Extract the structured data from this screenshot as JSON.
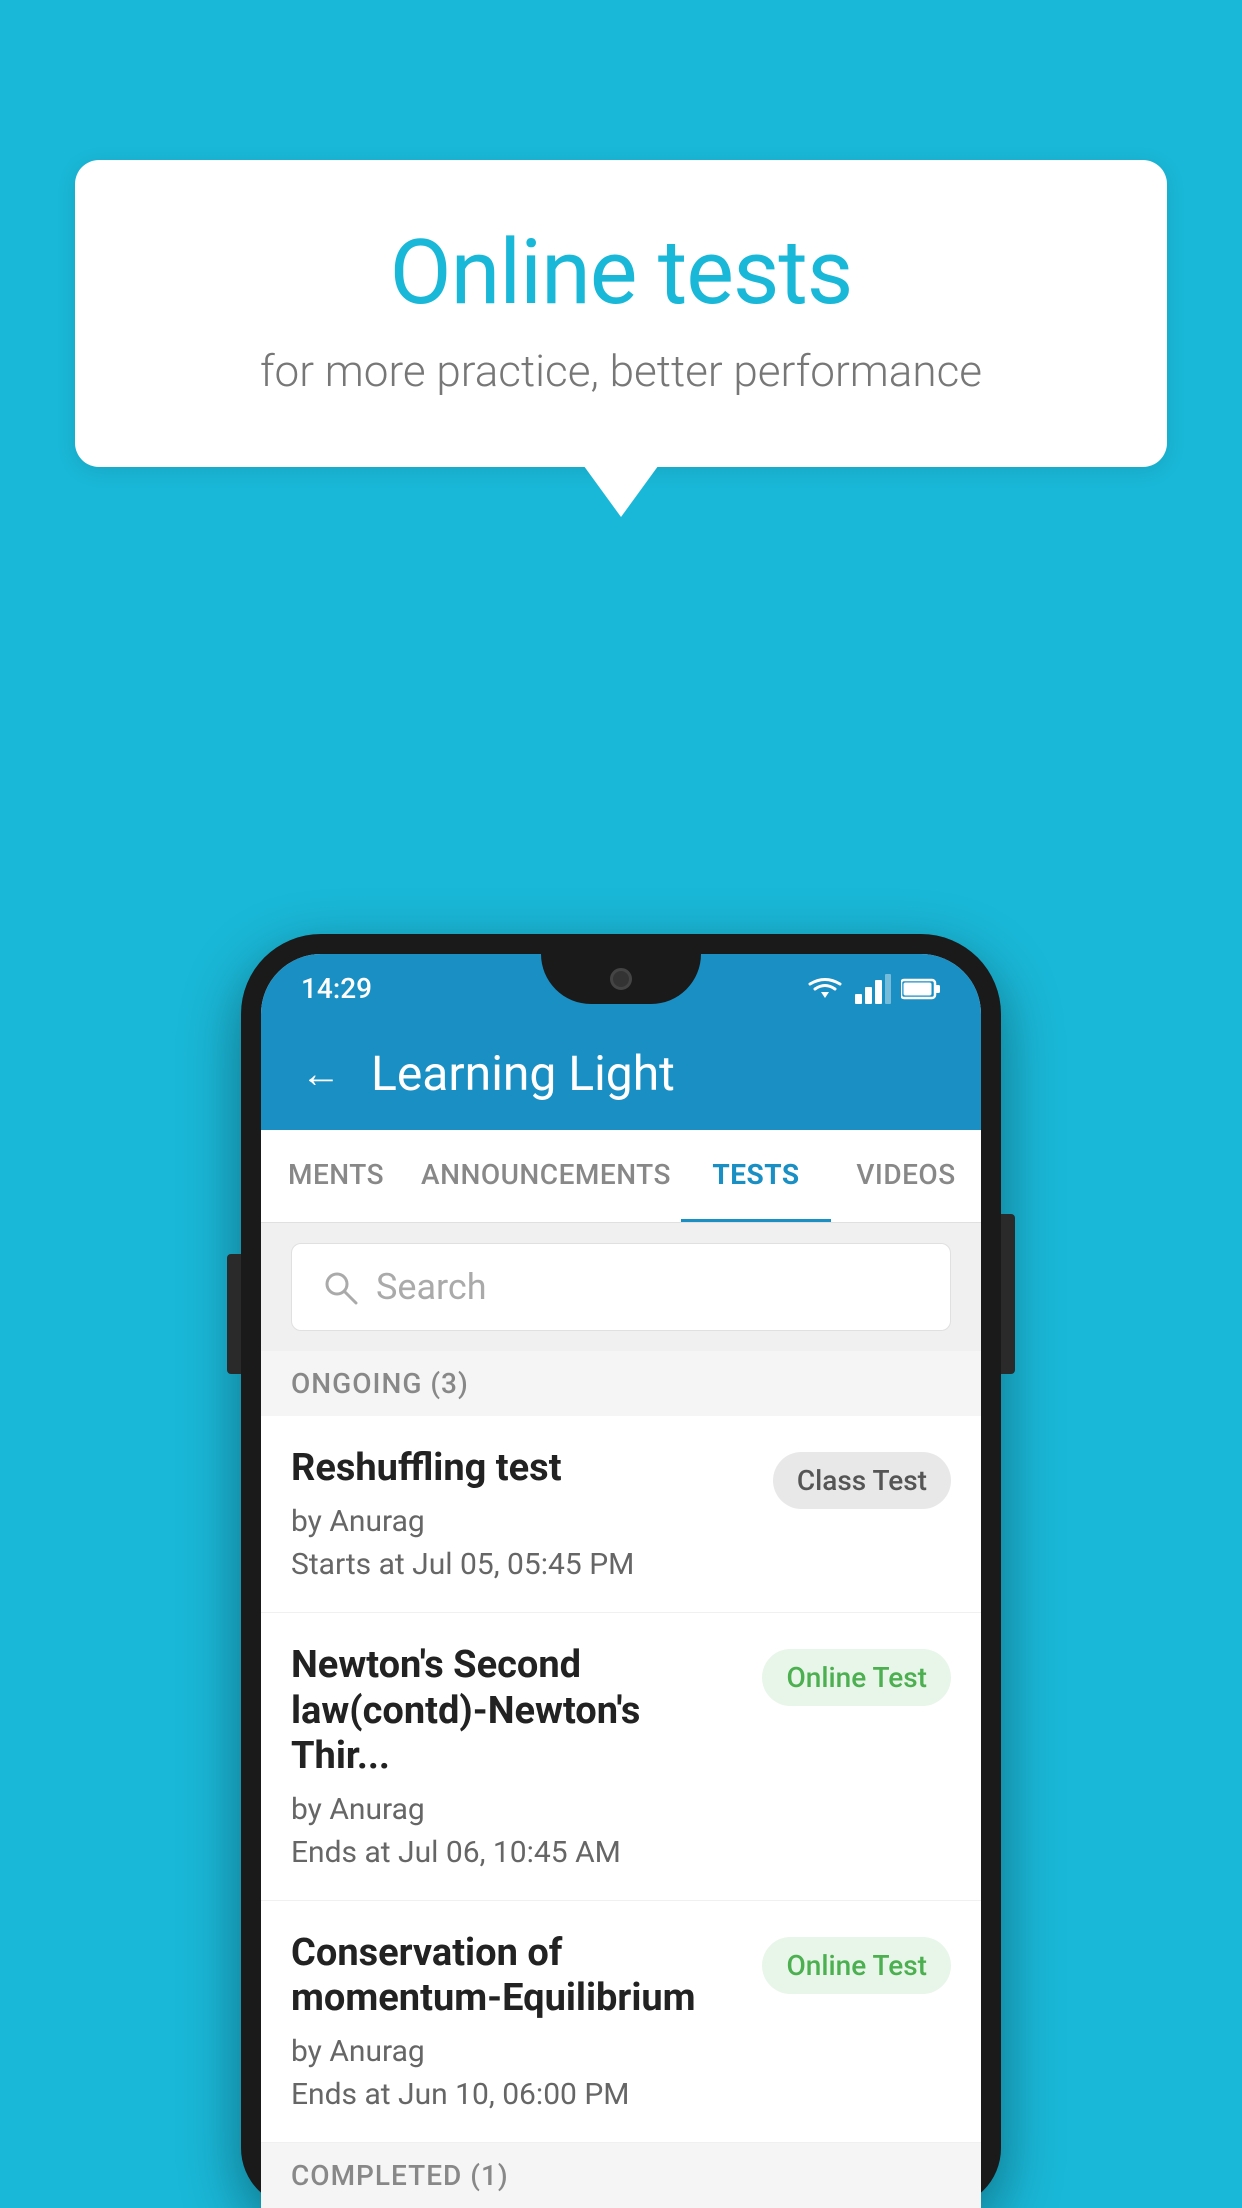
{
  "background_color": "#1ab8d8",
  "bubble": {
    "title": "Online tests",
    "subtitle": "for more practice, better performance"
  },
  "status_bar": {
    "time": "14:29",
    "icons": [
      "wifi",
      "signal",
      "battery"
    ]
  },
  "app_bar": {
    "back_label": "←",
    "title": "Learning Light"
  },
  "tabs": [
    {
      "label": "MENTS",
      "active": false
    },
    {
      "label": "ANNOUNCEMENTS",
      "active": false
    },
    {
      "label": "TESTS",
      "active": true
    },
    {
      "label": "VIDEOS",
      "active": false
    }
  ],
  "search": {
    "placeholder": "Search"
  },
  "ongoing_section": {
    "label": "ONGOING (3)"
  },
  "tests": [
    {
      "title": "Reshuffling test",
      "author": "by Anurag",
      "time": "Starts at  Jul 05, 05:45 PM",
      "badge": "Class Test",
      "badge_type": "class"
    },
    {
      "title": "Newton's Second law(contd)-Newton's Thir...",
      "author": "by Anurag",
      "time": "Ends at  Jul 06, 10:45 AM",
      "badge": "Online Test",
      "badge_type": "online"
    },
    {
      "title": "Conservation of momentum-Equilibrium",
      "author": "by Anurag",
      "time": "Ends at  Jun 10, 06:00 PM",
      "badge": "Online Test",
      "badge_type": "online"
    }
  ],
  "completed_section": {
    "label": "COMPLETED (1)"
  }
}
